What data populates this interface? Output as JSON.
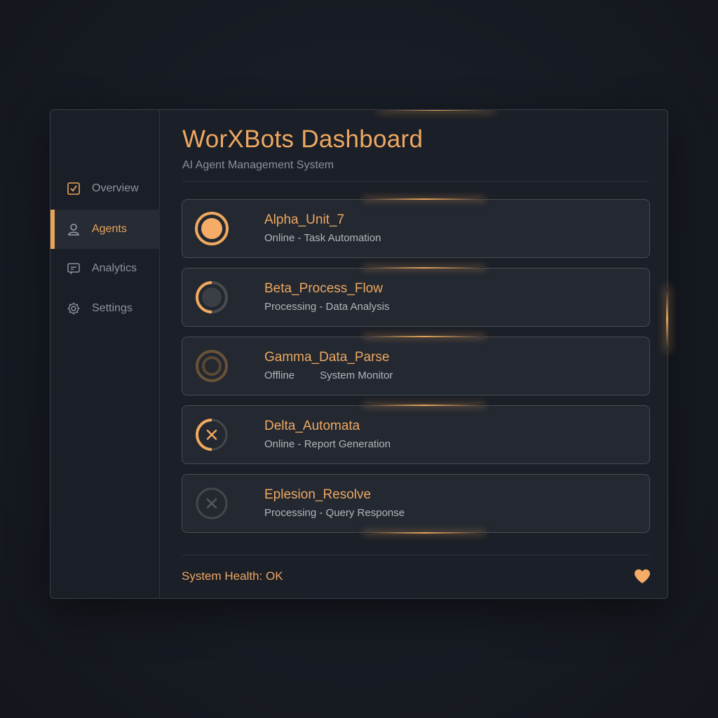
{
  "app": {
    "title": "WorXBots Dashboard",
    "subtitle": "AI Agent Management System"
  },
  "sidebar": {
    "items": [
      {
        "label": "Overview",
        "icon": "checkbox-icon",
        "active": false
      },
      {
        "label": "Agents",
        "icon": "user-icon",
        "active": true
      },
      {
        "label": "Analytics",
        "icon": "chart-icon",
        "active": false
      },
      {
        "label": "Settings",
        "icon": "gear-icon",
        "active": false
      }
    ]
  },
  "agents": [
    {
      "name": "Alpha_Unit_7",
      "status": "Online - Task Automation",
      "icon": "online-status-icon"
    },
    {
      "name": "Beta_Process_Flow",
      "status": "Processing - Data Analysis",
      "icon": "processing-status-icon"
    },
    {
      "name": "Gamma_Data_Parse",
      "status_left": "Offline",
      "status_right": "System Monitor",
      "icon": "offline-status-icon"
    },
    {
      "name": "Delta_Automata",
      "status": "Online - Report Generation",
      "icon": "error-status-icon"
    },
    {
      "name": "Eplesion_Resolve",
      "status": "Processing - Query Response",
      "icon": "inactive-error-status-icon"
    }
  ],
  "footer": {
    "health": "System Health: OK",
    "icon": "heart-icon"
  },
  "colors": {
    "accent": "#eea862",
    "background": "#171b23",
    "card": "#232831"
  }
}
